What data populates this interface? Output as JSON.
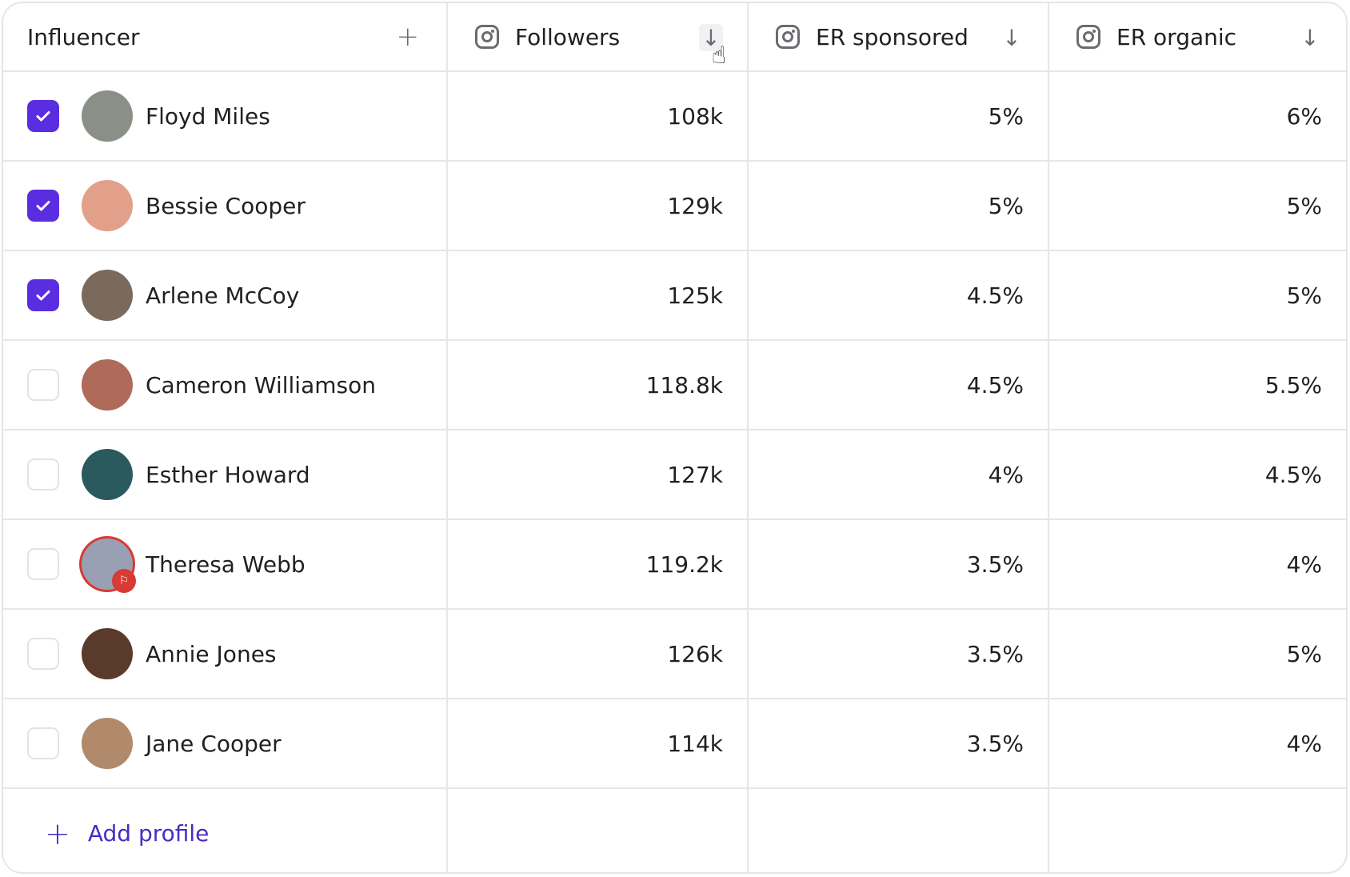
{
  "header": {
    "influencer": "Influencer",
    "add_column_icon": "plus-icon",
    "columns": [
      {
        "label": "Followers",
        "icon": "instagram-icon",
        "sort_icon": "arrow-down-icon"
      },
      {
        "label": "ER sponsored",
        "icon": "instagram-icon",
        "sort_icon": "arrow-down-icon"
      },
      {
        "label": "ER organic",
        "icon": "instagram-icon",
        "sort_icon": "arrow-down-icon"
      }
    ]
  },
  "rows": [
    {
      "name": "Floyd Miles",
      "checked": true,
      "followers": "108k",
      "er_sponsored": "5%",
      "er_organic": "6%",
      "avatar_color": "#8a8f88"
    },
    {
      "name": "Bessie Cooper",
      "checked": true,
      "followers": "129k",
      "er_sponsored": "5%",
      "er_organic": "5%",
      "avatar_color": "#e2a08a"
    },
    {
      "name": "Arlene McCoy",
      "checked": true,
      "followers": "125k",
      "er_sponsored": "4.5%",
      "er_organic": "5%",
      "avatar_color": "#7a6a5e"
    },
    {
      "name": "Cameron Williamson",
      "checked": false,
      "followers": "118.8k",
      "er_sponsored": "4.5%",
      "er_organic": "5.5%",
      "avatar_color": "#b06a5a"
    },
    {
      "name": "Esther Howard",
      "checked": false,
      "followers": "127k",
      "er_sponsored": "4%",
      "er_organic": "4.5%",
      "avatar_color": "#2a5a5e"
    },
    {
      "name": "Theresa Webb",
      "checked": false,
      "followers": "119.2k",
      "er_sponsored": "3.5%",
      "er_organic": "4%",
      "avatar_color": "#9aa0b4",
      "flagged": true
    },
    {
      "name": "Annie Jones",
      "checked": false,
      "followers": "126k",
      "er_sponsored": "3.5%",
      "er_organic": "5%",
      "avatar_color": "#5a3a2a"
    },
    {
      "name": "Jane Cooper",
      "checked": false,
      "followers": "114k",
      "er_sponsored": "3.5%",
      "er_organic": "4%",
      "avatar_color": "#b08a6a"
    }
  ],
  "footer": {
    "add_profile": "Add profile",
    "add_icon": "plus-icon"
  },
  "colors": {
    "accent": "#5a2de0",
    "link": "#4a2bc4",
    "flag": "#d83a34",
    "border": "#e6e6e8"
  }
}
